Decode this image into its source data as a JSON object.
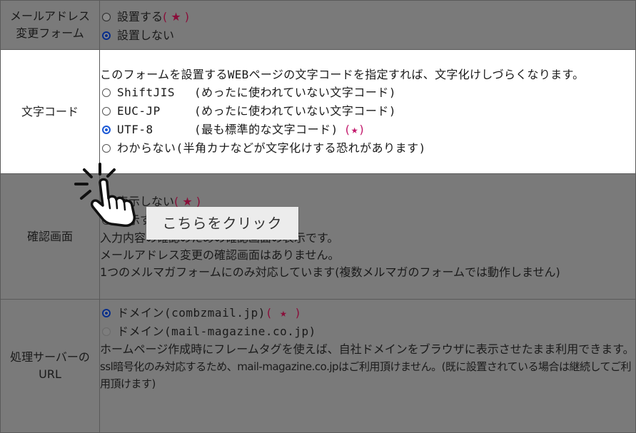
{
  "rows": {
    "email_change": {
      "label_line1": "メールアドレス",
      "label_line2": "変更フォーム",
      "opt1": "設置する",
      "opt1_star": "( ★ )",
      "opt2": "設置しない"
    },
    "charset": {
      "label": "文字コード",
      "desc": "このフォームを設置するWEBページの文字コードを指定すれば、文字化けしづらくなります。",
      "options": [
        {
          "name": "ShiftJIS",
          "note": "(めったに使われていない文字コード)",
          "star": ""
        },
        {
          "name": "EUC-JP",
          "note": "(めったに使われていない文字コード)",
          "star": ""
        },
        {
          "name": "UTF-8",
          "note": "(最も標準的な文字コード)",
          "star": "(★)"
        },
        {
          "name": "わからない",
          "note": "(半角カナなどが文字化けする恐れがあります)",
          "star": ""
        }
      ],
      "selected": "UTF-8"
    },
    "confirm": {
      "label": "確認画面",
      "opt1": "表示しない",
      "opt1_star": "( ★ )",
      "opt2": "表示する",
      "line1": "入力内容の確認のための確認画面の表示です。",
      "line2": "メールアドレス変更の確認画面はありません。",
      "line3": "1つのメルマガフォームにのみ対応しています(複数メルマガのフォームでは動作しません)"
    },
    "server": {
      "label_line1": "処理サーバーの",
      "label_line2": "URL",
      "opt1": "ドメイン(combzmail.jp)",
      "opt1_star": "( ★ )",
      "opt2": "ドメイン(mail-magazine.co.jp)",
      "line1": "ホームページ作成時にフレームタグを使えば、自社ドメインをブラウザに表示させたまま利用できます。",
      "line2": "ssl暗号化のみ対応するため、mail-magazine.co.jpはご利用頂けません。(既に設置されている場合は継続してご利用頂けます)"
    }
  },
  "tooltip": {
    "text": "こちらをクリック"
  },
  "icons": {
    "pointer": "hand-pointer-click-icon"
  },
  "colors": {
    "overlay": "#7a7a7a",
    "highlight": "#ffffff",
    "star": "#c2186b",
    "radio_on": "#1e5bd6"
  }
}
